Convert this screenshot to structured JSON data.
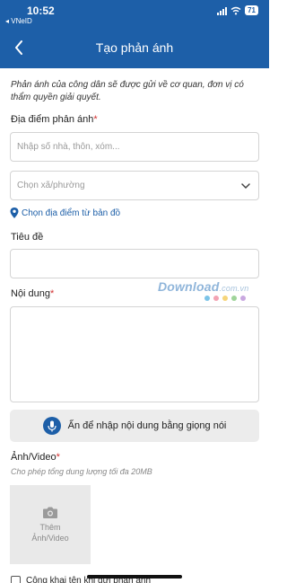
{
  "status": {
    "time": "10:52",
    "carrier": "◂ VNeID",
    "battery": "71"
  },
  "header": {
    "title": "Tạo phản ánh"
  },
  "intro": "Phản ánh của công dân sẽ được gửi về cơ quan, đơn vị có thẩm quyền giải quyết.",
  "location": {
    "label": "Địa điểm phản ánh",
    "required": "*",
    "address_placeholder": "Nhập số nhà, thôn, xóm...",
    "ward_placeholder": "Chọn xã/phường",
    "map_link": "Chọn địa điểm từ bản đồ"
  },
  "title_field": {
    "label": "Tiêu đề",
    "value": ""
  },
  "content": {
    "label": "Nội dung",
    "required": "*",
    "value": ""
  },
  "voice_button": "Ấn để nhập nội dung bằng giọng nói",
  "media": {
    "label": "Ảnh/Video",
    "required": "*",
    "subtitle": "Cho phép tổng dung lượng tối đa 20MB",
    "add_label": "Thêm Ảnh/Video"
  },
  "public_checkbox": "Công khai tên khi gửi phản ánh",
  "watermark": {
    "brand": "Download",
    "suffix": ".com.vn"
  },
  "colors": {
    "primary": "#1d5fa8",
    "required": "#d32f2f"
  }
}
